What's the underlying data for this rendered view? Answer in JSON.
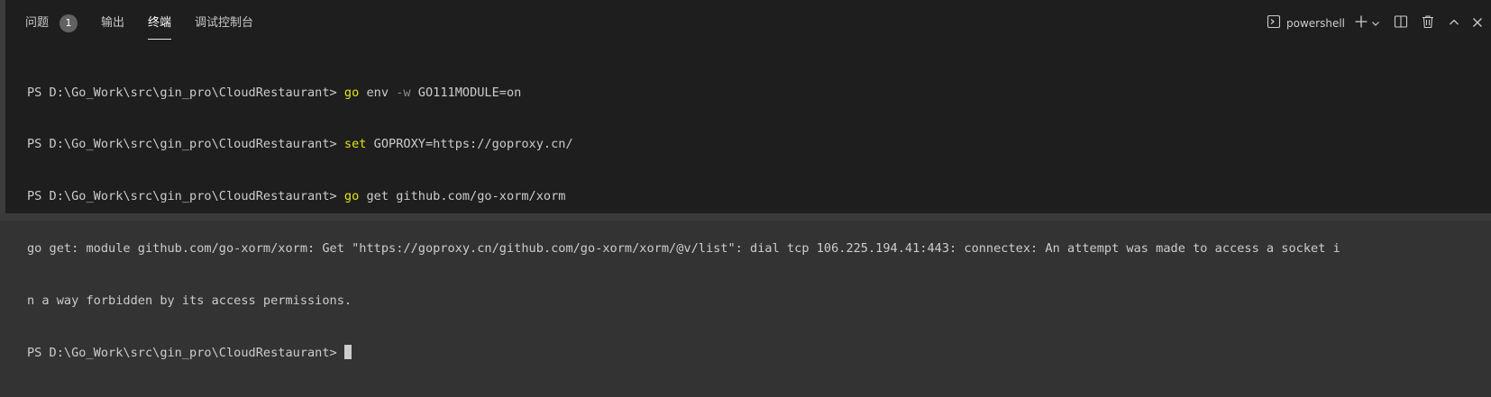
{
  "tabs": [
    {
      "label": "问题",
      "badge": "1"
    },
    {
      "label": "输出"
    },
    {
      "label": "终端",
      "active": true
    },
    {
      "label": "调试控制台"
    }
  ],
  "toolbar": {
    "shell_label": "powershell",
    "icons": [
      "terminal-icon",
      "plus-icon",
      "chevron-down-icon",
      "split-icon",
      "trash-icon",
      "chevron-up-icon",
      "close-icon"
    ]
  },
  "terminal": {
    "prompt": "PS D:\\Go_Work\\src\\gin_pro\\CloudRestaurant> ",
    "line1": {
      "cmd": "go",
      "rest1": " env ",
      "flag": "-w",
      "rest2": " GO111MODULE=on"
    },
    "line2": {
      "cmd": "set",
      "rest": " GOPROXY=https://goproxy.cn/"
    },
    "line3": {
      "cmd": "go",
      "rest": " get github.com/go-xorm/xorm"
    },
    "error_line1": "go get: module github.com/go-xorm/xorm: Get \"https://goproxy.cn/github.com/go-xorm/xorm/@v/list\": dial tcp 106.225.194.41:443: connectex: An attempt was made to access a socket i",
    "error_line2": "n a way forbidden by its access permissions."
  },
  "colors": {
    "background": "#1e1e1e",
    "command": "#e5e510",
    "text": "#cccccc"
  }
}
